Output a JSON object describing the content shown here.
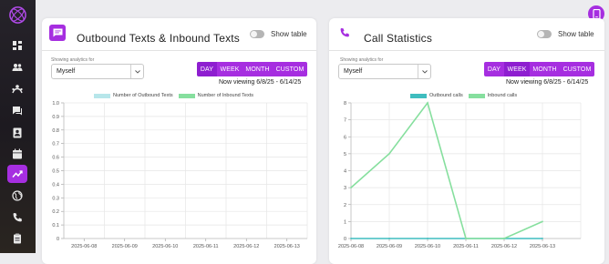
{
  "colors": {
    "accent": "#a62ee0",
    "accent_dark": "#8e1ed0",
    "outbound_texts": "#b7e6ea",
    "inbound_texts": "#86df9e",
    "outbound_calls": "#3fbdbf",
    "inbound_calls": "#86df9e"
  },
  "sidebar": {
    "logo": "orbit-logo",
    "items": [
      {
        "icon": "dashboard-icon"
      },
      {
        "icon": "users-icon"
      },
      {
        "icon": "team-icon"
      },
      {
        "icon": "messages-icon"
      },
      {
        "icon": "contacts-icon"
      },
      {
        "icon": "calendar-icon"
      },
      {
        "icon": "analytics-icon",
        "active": true
      },
      {
        "icon": "globe-icon"
      },
      {
        "icon": "phone-icon"
      },
      {
        "icon": "clipboard-icon"
      }
    ]
  },
  "texts_panel": {
    "title": "Outbound Texts & Inbound Texts",
    "toggle_label": "Show table",
    "showing_label": "Showing analytics for",
    "select_value": "Myself",
    "ranges": [
      "DAY",
      "WEEK",
      "MONTH",
      "CUSTOM"
    ],
    "selected_range": "DAY",
    "now_viewing": "Now viewing 6/8/25 - 6/14/25",
    "legend": [
      "Number of Outbound Texts",
      "Number of Inbound Texts"
    ]
  },
  "calls_panel": {
    "title": "Call Statistics",
    "toggle_label": "Show table",
    "showing_label": "Showing analytics for",
    "select_value": "Myself",
    "ranges": [
      "DAY",
      "WEEK",
      "MONTH",
      "CUSTOM"
    ],
    "selected_range": "WEEK",
    "now_viewing": "Now viewing 6/8/25 - 6/14/25",
    "legend": [
      "Outbound calls",
      "Inbound calls"
    ]
  },
  "chart_data": [
    {
      "type": "bar",
      "categories": [
        "2025-06-08",
        "2025-06-09",
        "2025-06-10",
        "2025-06-11",
        "2025-06-12",
        "2025-06-13"
      ],
      "series": [
        {
          "name": "Number of Outbound Texts",
          "values": [
            0,
            0,
            0,
            0,
            0,
            0
          ]
        },
        {
          "name": "Number of Inbound Texts",
          "values": [
            0,
            0,
            0,
            0,
            0,
            0
          ]
        }
      ],
      "yticks": [
        "0",
        "0.1",
        "0.2",
        "0.3",
        "0.4",
        "0.5",
        "0.6",
        "0.7",
        "0.8",
        "0.9",
        "1.0"
      ],
      "ylim": [
        0,
        1
      ],
      "grid": true,
      "legend": "top-center"
    },
    {
      "type": "line",
      "categories": [
        "2025-06-08",
        "2025-06-09",
        "2025-06-10",
        "2025-06-11",
        "2025-06-12",
        "2025-06-13"
      ],
      "series": [
        {
          "name": "Outbound calls",
          "values": [
            0,
            0,
            0,
            0,
            0,
            0
          ]
        },
        {
          "name": "Inbound calls",
          "values": [
            3,
            5,
            8,
            0,
            0,
            1
          ]
        }
      ],
      "yticks": [
        "0",
        "1",
        "2",
        "3",
        "4",
        "5",
        "6",
        "7",
        "8"
      ],
      "ylim": [
        0,
        8
      ],
      "grid": true,
      "legend": "top-center"
    }
  ]
}
